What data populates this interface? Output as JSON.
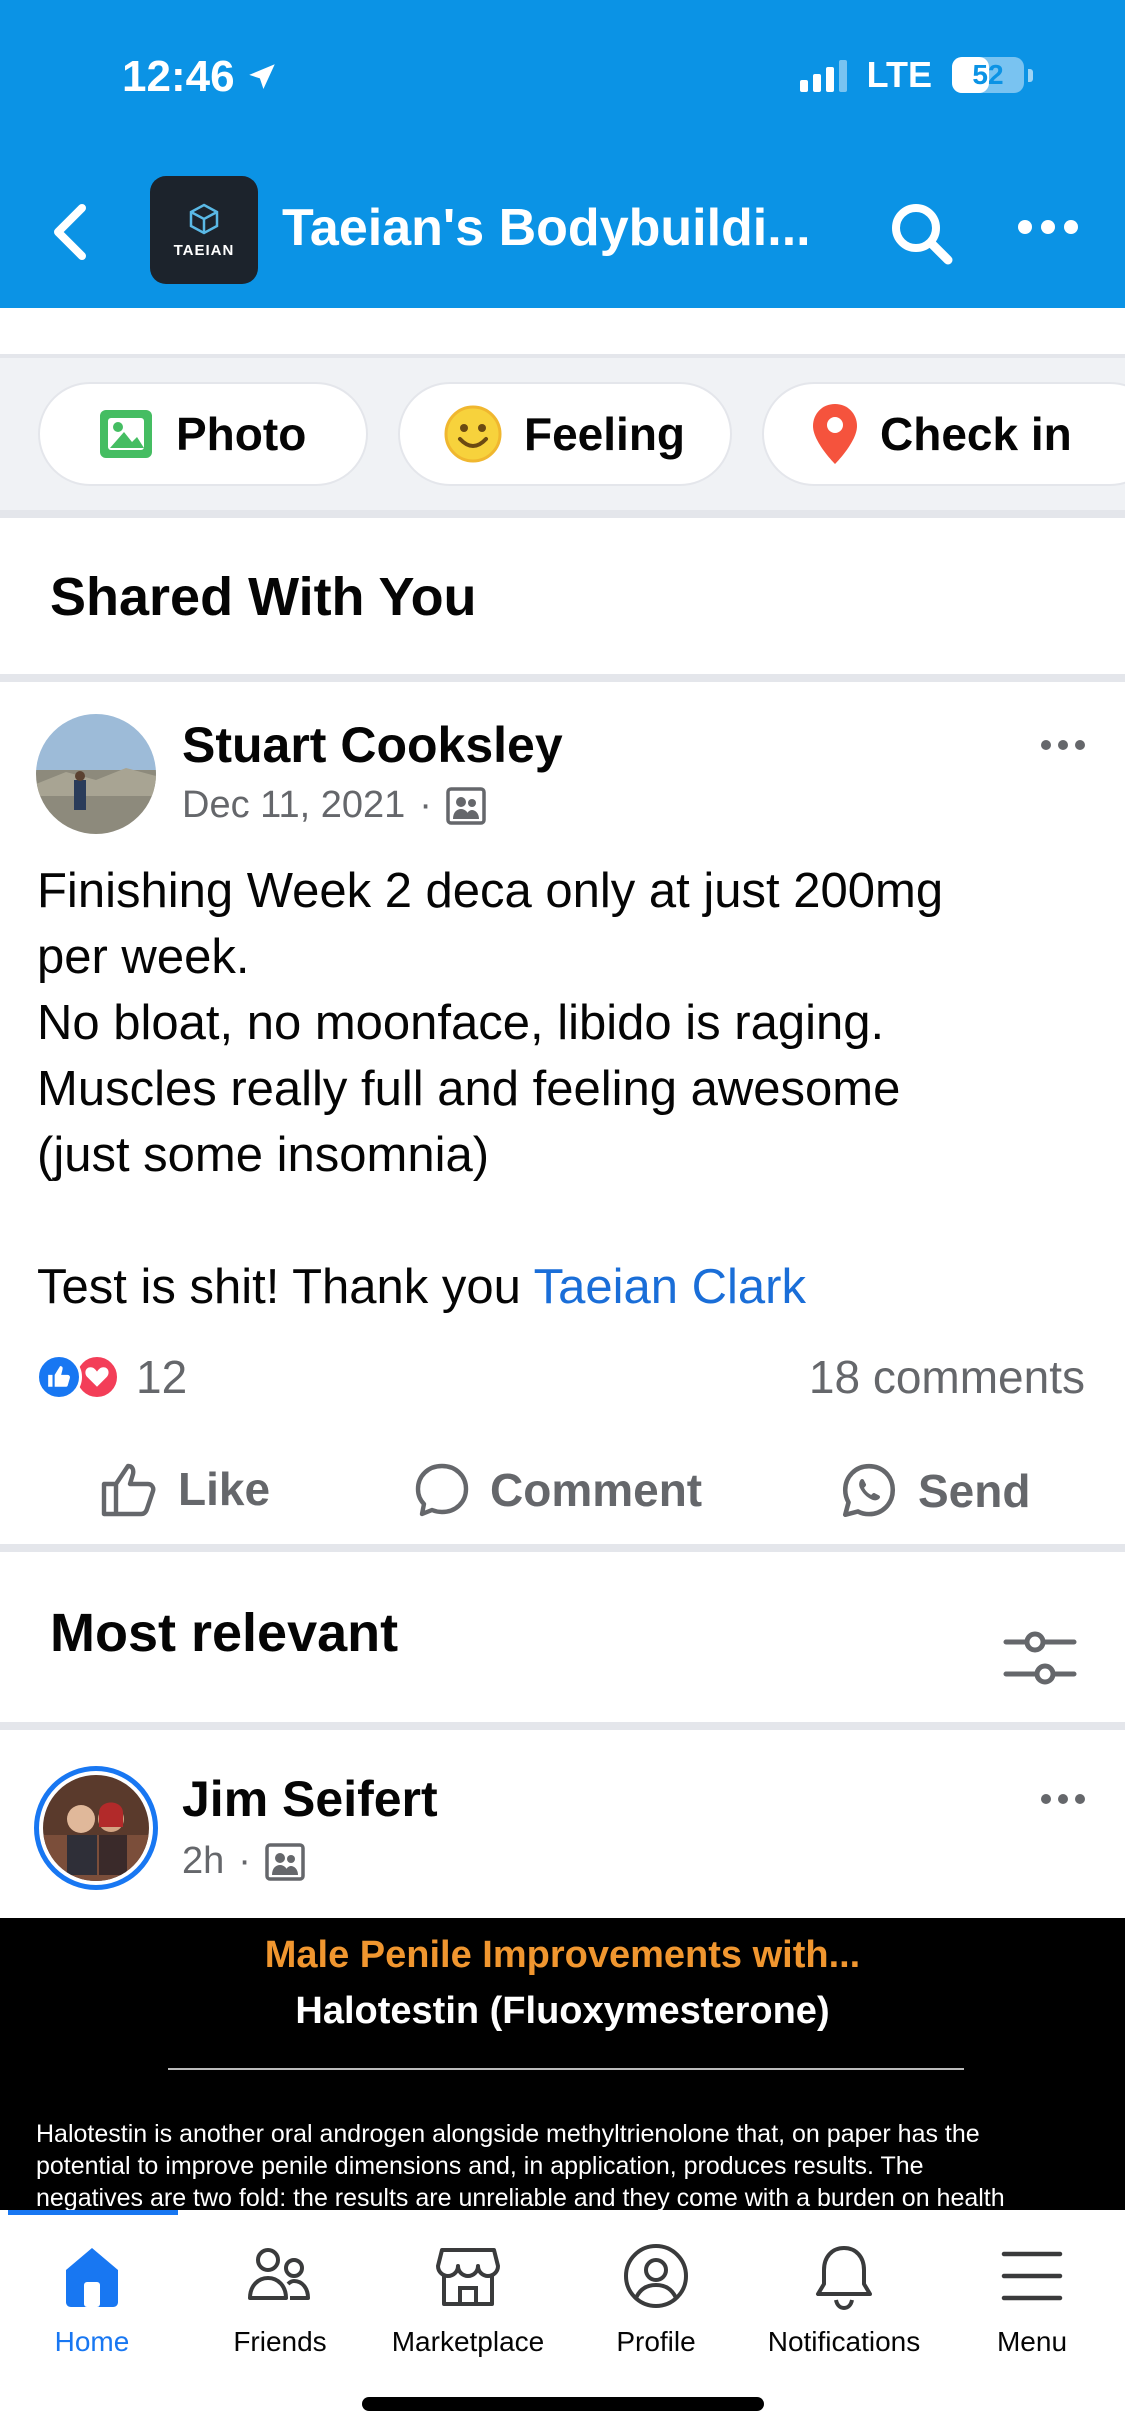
{
  "status_bar": {
    "time": "12:46",
    "network": "LTE",
    "battery": "52"
  },
  "header": {
    "title": "Taeian's Bodybuildi...",
    "group_logo_text": "TAEIAN"
  },
  "composer": {
    "photo_label": "Photo",
    "feeling_label": "Feeling",
    "checkin_label": "Check in"
  },
  "shared_section": {
    "title": "Shared With You"
  },
  "post": {
    "author": "Stuart Cooksley",
    "date": "Dec 11, 2021",
    "lines": [
      "Finishing Week 2 deca only at just 200mg",
      "per week.",
      "No bloat, no moonface, libido is raging.",
      "Muscles really full and feeling awesome",
      "(just some insomnia)"
    ],
    "last_line_prefix": "Test is shit! Thank you ",
    "mention": "Taeian Clark",
    "reaction_count": "12",
    "comments": "18 comments",
    "actions": {
      "like": "Like",
      "comment": "Comment",
      "send": "Send"
    }
  },
  "comments_section": {
    "title": "Most relevant"
  },
  "comment": {
    "author": "Jim Seifert",
    "time": "2h",
    "image": {
      "heading": "Male Penile Improvements with...",
      "subheading": "Halotestin (Fluoxymesterone)",
      "lines": [
        "Halotestin is another oral androgen alongside methyltrienolone that, on paper has the",
        "potential to improve penile dimensions and, in application, produces results. The",
        "negatives are two fold: the results are unreliable and they come with a burden on health"
      ]
    }
  },
  "tabbar": {
    "home": "Home",
    "friends": "Friends",
    "marketplace": "Marketplace",
    "profile": "Profile",
    "notifications": "Notifications",
    "menu": "Menu"
  },
  "colors": {
    "header_bg": "#0b93e5",
    "accent": "#1877f2",
    "mention": "#1a6ed8",
    "like_blue": "#1877f2",
    "love_red": "#f33e58"
  }
}
